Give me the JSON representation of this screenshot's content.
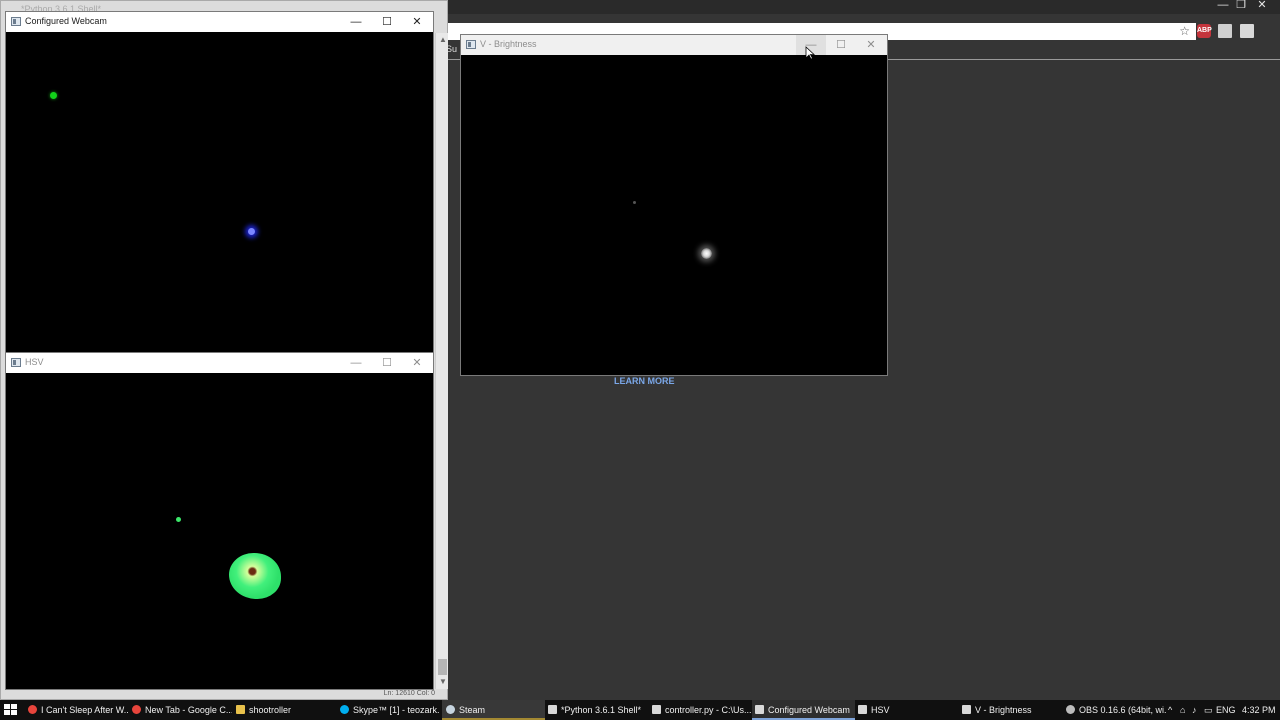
{
  "browser": {
    "tab_sliver": "Su",
    "learn_more": "LEARN MORE",
    "extension_badge": "ABP",
    "controls": {
      "minimize": "—",
      "restore": "❐",
      "close": "✕"
    }
  },
  "python_shell": {
    "title": "*Python 3.6.1 Shell*",
    "status": "Ln: 12610   Col: 0"
  },
  "windows": {
    "webcam": {
      "title": "Configured Webcam",
      "icon": "window-app-icon"
    },
    "hsv": {
      "title": "HSV",
      "icon": "window-app-icon"
    },
    "brightness": {
      "title": "V - Brightness",
      "icon": "window-app-icon"
    },
    "controls": {
      "minimize": "—",
      "maximize": "☐",
      "close": "✕"
    }
  },
  "taskbar": {
    "items": [
      {
        "label": "I Can't Sleep After W...",
        "icon": "chrome-icon",
        "color": "#e8453c"
      },
      {
        "label": "New Tab - Google C...",
        "icon": "chrome-icon",
        "color": "#e8453c"
      },
      {
        "label": "shootroller",
        "icon": "folder-icon",
        "color": "#e8c14b"
      },
      {
        "label": "Skype™ [1] - teozark...",
        "icon": "skype-icon",
        "color": "#00aff0"
      },
      {
        "label": "Steam",
        "icon": "steam-icon",
        "color": "#c7d5e0"
      },
      {
        "label": "*Python 3.6.1 Shell*",
        "icon": "python-icon",
        "color": "#d8d8d8"
      },
      {
        "label": "controller.py - C:\\Us...",
        "icon": "python-icon",
        "color": "#d8d8d8"
      },
      {
        "label": "Configured Webcam",
        "icon": "window-icon",
        "color": "#d8d8d8"
      },
      {
        "label": "HSV",
        "icon": "window-icon",
        "color": "#d8d8d8"
      },
      {
        "label": "V - Brightness",
        "icon": "window-icon",
        "color": "#d8d8d8"
      },
      {
        "label": "OBS 0.16.6 (64bit, wi...",
        "icon": "obs-icon",
        "color": "#bbbbbb"
      }
    ],
    "tray": {
      "chevron": "^",
      "language": "ENG",
      "time": "4:32 PM"
    }
  }
}
